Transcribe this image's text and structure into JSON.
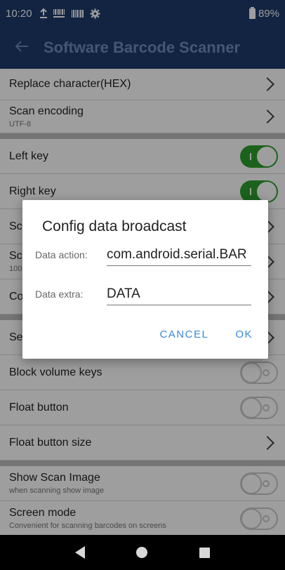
{
  "status_bar": {
    "time": "10:20",
    "battery": "89%",
    "icons": [
      "upload-icon",
      "barcode-icon",
      "barcode-icon",
      "gear-icon"
    ]
  },
  "app_bar": {
    "title": "Software Barcode Scanner",
    "back_icon": "arrow-left-icon"
  },
  "settings": {
    "replace_char": "Replace character(HEX)",
    "scan_encoding": {
      "label": "Scan encoding",
      "value": "UTF-8"
    },
    "left_key": {
      "label": "Left key",
      "state": "on"
    },
    "right_key": {
      "label": "Right key",
      "state": "on"
    },
    "row_sc1": "Sc",
    "row_sc2": {
      "label": "Sc",
      "sub": "100"
    },
    "row_co": "Co",
    "row_se": "Se",
    "block_volume": {
      "label": "Block volume keys",
      "state": "off"
    },
    "float_button": {
      "label": "Float button",
      "state": "off"
    },
    "float_button_size": "Float button size",
    "show_scan_image": {
      "label": "Show Scan Image",
      "sub": "when scanning show image",
      "state": "off"
    },
    "screen_mode": {
      "label": "Screen mode",
      "sub": "Convenient for scanning barcodes on screens",
      "state": "off"
    }
  },
  "dialog": {
    "title": "Config data broadcast",
    "action_label": "Data action:",
    "action_value": "com.android.serial.BAR",
    "extra_label": "Data extra:",
    "extra_value": "DATA",
    "cancel": "CANCEL",
    "ok": "OK"
  },
  "colors": {
    "primary": "#1d3a6b",
    "accent": "#3a8ad6",
    "switch_on": "#2e9e2e"
  }
}
